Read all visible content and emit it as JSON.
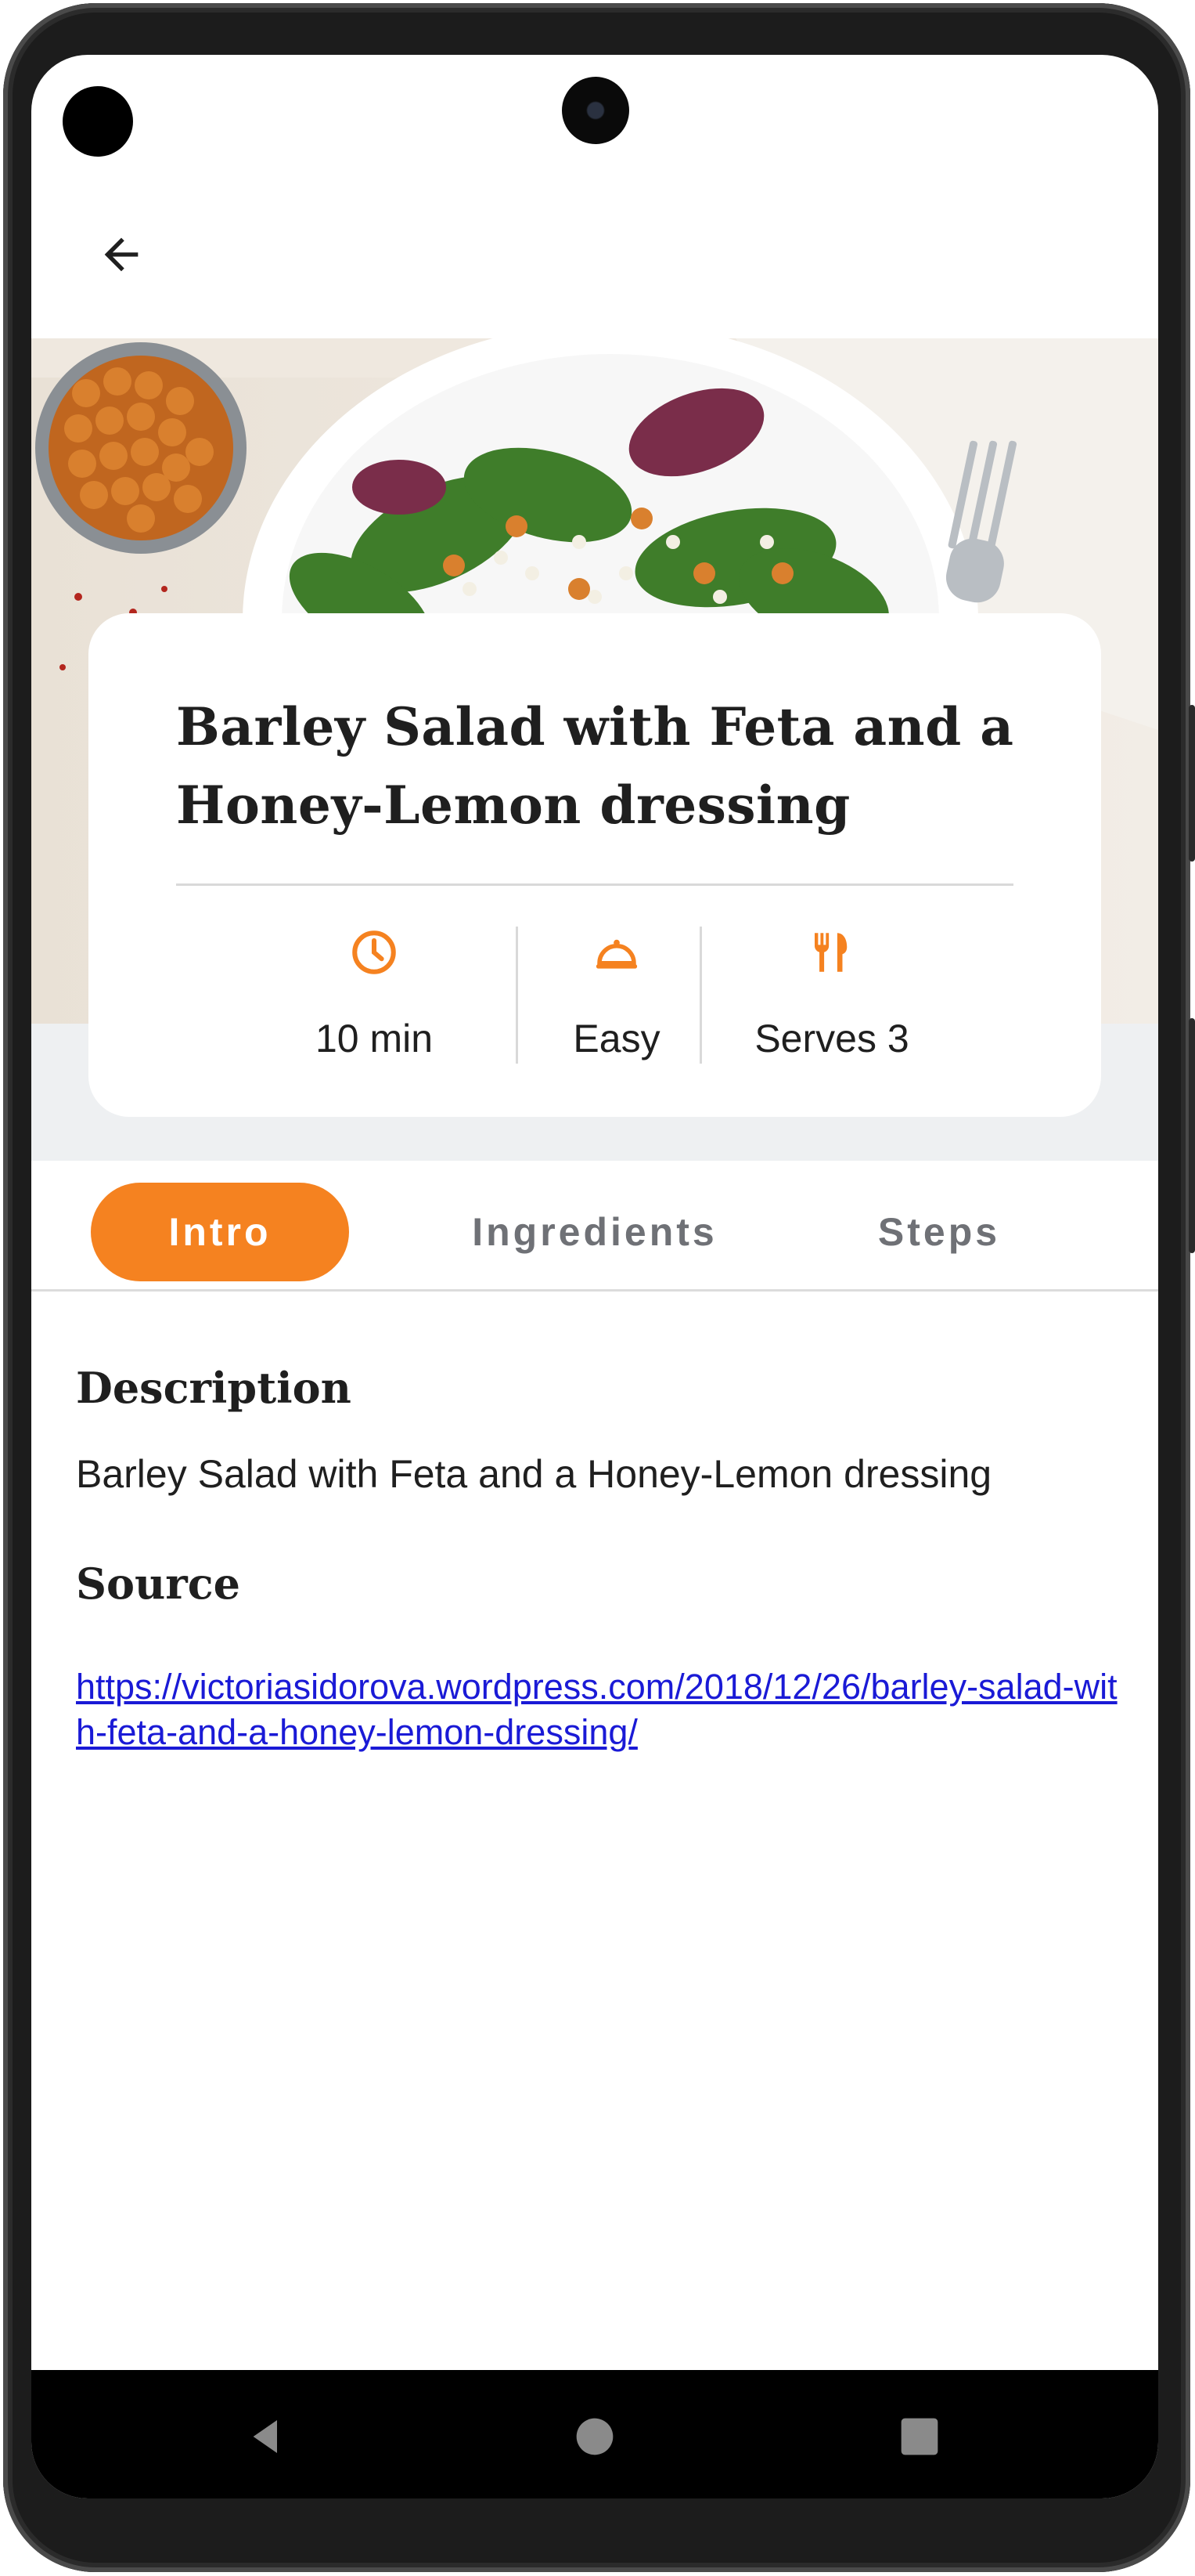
{
  "app": {
    "back_label": "Back"
  },
  "recipe": {
    "title": "Barley Salad with Feta and a Honey-Lemon dressing",
    "stats": {
      "time": "10 min",
      "difficulty": "Easy",
      "servings": "Serves 3"
    }
  },
  "tabs": [
    {
      "label": "Intro",
      "active": true
    },
    {
      "label": "Ingredients",
      "active": false
    },
    {
      "label": "Steps",
      "active": false
    }
  ],
  "intro": {
    "description_heading": "Description",
    "description": "Barley Salad with Feta and a Honey-Lemon dressing",
    "source_heading": "Source",
    "source_url": "https://victoriasidorova.wordpress.com/2018/12/26/barley-salad-with-feta-and-a-honey-lemon-dressing/"
  },
  "icons": {
    "back": "arrow-left-icon",
    "time": "clock-icon",
    "difficulty": "cloche-icon",
    "servings": "fork-knife-icon",
    "nav_back": "triangle-back-icon",
    "nav_home": "circle-home-icon",
    "nav_recents": "square-recents-icon"
  },
  "colors": {
    "accent": "#f58220",
    "link": "#1a1ad6",
    "text": "#1f1f1f",
    "muted": "#6f7176"
  }
}
